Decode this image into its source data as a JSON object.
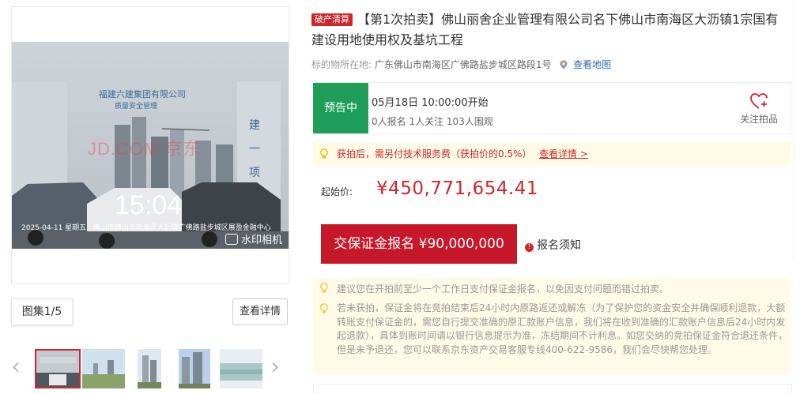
{
  "gallery": {
    "watermark_logo": "JD.COM 京东",
    "photo_time": "15:04",
    "photo_caption": "2025-04-11 星期五 · 佛山市佛山市南海区大沥镇广佛路盐步城区展盈金融中心",
    "camera_app": "水印相机",
    "count_label": "图集1/5",
    "detail_button": "查看详情"
  },
  "item": {
    "tag": "破产清算",
    "title": "【第1次拍卖】佛山丽舍企业管理有限公司名下佛山市南海区大沥镇1宗国有建设用地使用权及基坑工程",
    "location_label": "标的物所在地:",
    "location": "广东佛山市南海区广佛路盐步城区路段1号",
    "map_link": "查看地图"
  },
  "status": {
    "badge": "预告中",
    "start_time": "05月18日 10:00:00开始",
    "counts": "0人报名  1人关注  103人围观",
    "follow_label": "关注拍品"
  },
  "fee_tip": {
    "text": "获拍后，需另付技术服务费（获拍价的0.5%）",
    "link": "查看详情 >"
  },
  "price": {
    "label": "起始价:",
    "value": "¥450,771,654.41"
  },
  "deposit": {
    "button": "交保证金报名 ¥90,000,000",
    "notice": "报名须知"
  },
  "tips": {
    "tip1": "建议您在开拍前至少一个工作日支付保证金报名，以免因支付问题而错过拍卖。",
    "tip2": "若未获拍，保证金将在竞拍结束后24小时内原路返还或解冻（为了保护您的资金安全并确保顺利退款，大额转账支付保证金的，需您自行提交准确的原汇款账户信息，我们将在收到准确的汇款账户信息后24小时内发起退款），具体到账时间请以银行信息提示为准，冻结期间不计利息。如您交纳的竞拍保证金符合退还条件，但是未予退还，您可以联系京东资产交易客服专线400-622-9586，我们会尽快帮您处理。"
  },
  "colors": {
    "accent_red": "#d0252b",
    "status_green": "#1f9e5a",
    "link_blue": "#2d67b0",
    "tip_bg": "#fffbe6"
  }
}
